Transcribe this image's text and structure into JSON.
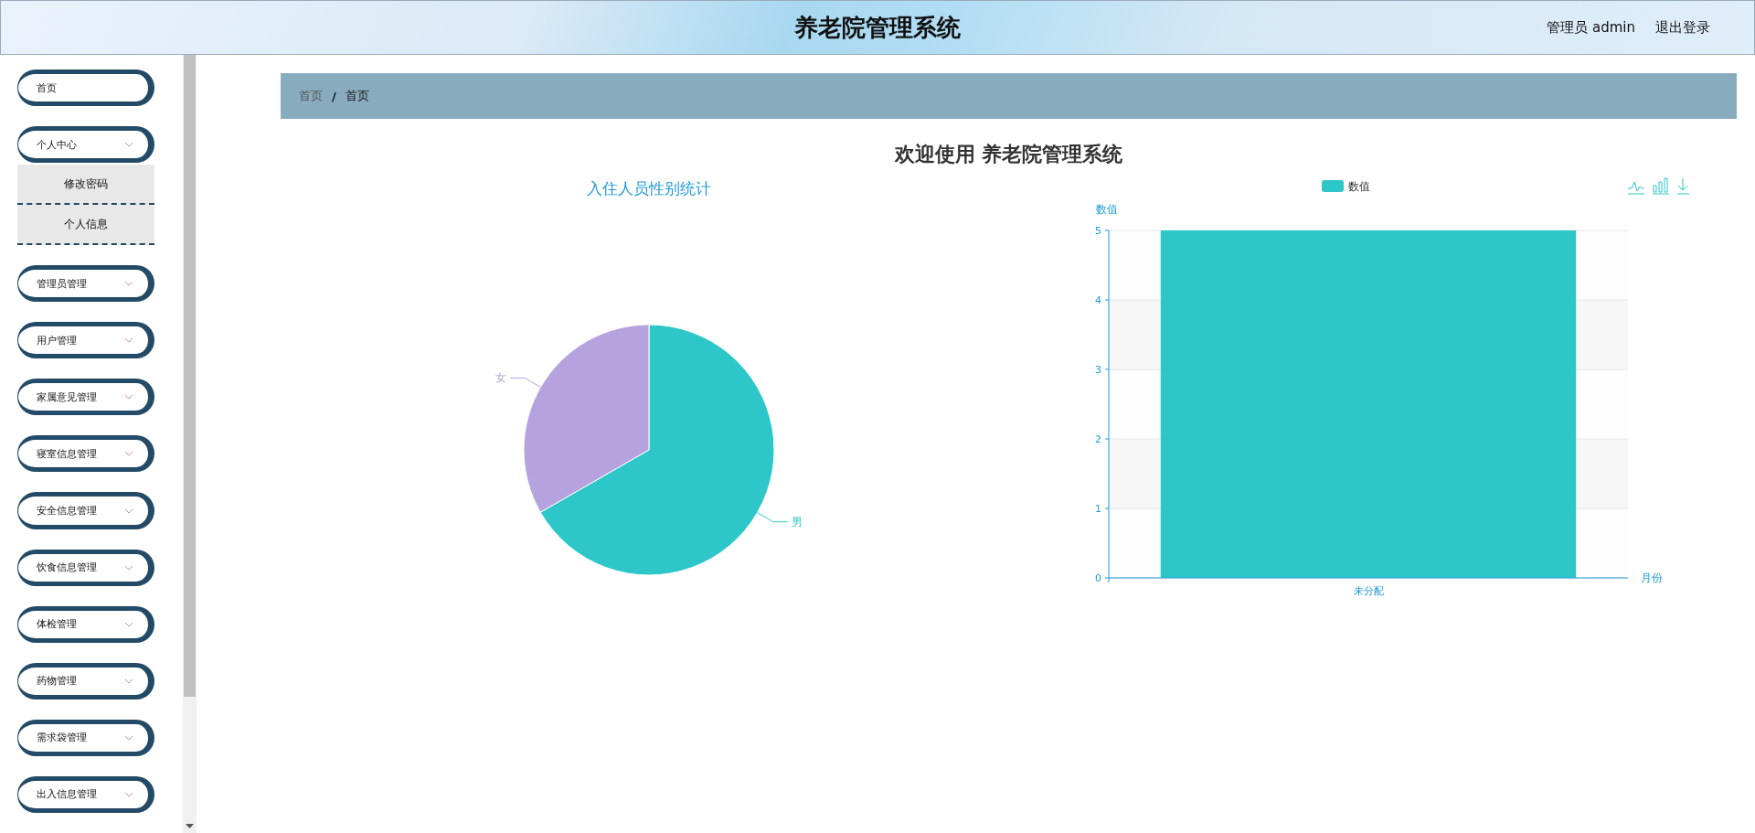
{
  "header": {
    "title": "养老院管理系统",
    "user": "管理员 admin",
    "logout": "退出登录"
  },
  "sidebar": {
    "items": [
      {
        "label": "首页",
        "kind": "link"
      },
      {
        "label": "个人中心",
        "kind": "menu",
        "expanded": true,
        "children": [
          {
            "label": "修改密码"
          },
          {
            "label": "个人信息"
          }
        ]
      },
      {
        "label": "管理员管理",
        "kind": "menu",
        "expanded": false
      },
      {
        "label": "用户管理",
        "kind": "menu",
        "expanded": false
      },
      {
        "label": "家属意见管理",
        "kind": "menu",
        "expanded": false
      },
      {
        "label": "寝室信息管理",
        "kind": "menu",
        "expanded": false
      },
      {
        "label": "安全信息管理",
        "kind": "menu",
        "expanded": false
      },
      {
        "label": "饮食信息管理",
        "kind": "menu",
        "expanded": false
      },
      {
        "label": "体检管理",
        "kind": "menu",
        "expanded": false
      },
      {
        "label": "药物管理",
        "kind": "menu",
        "expanded": false
      },
      {
        "label": "需求袋管理",
        "kind": "menu",
        "expanded": false
      },
      {
        "label": "出入信息管理",
        "kind": "menu",
        "expanded": false
      }
    ]
  },
  "breadcrumb": {
    "items": [
      "首页",
      "首页"
    ],
    "separator": "/"
  },
  "welcome": "欢迎使用 养老院管理系统",
  "pie": {
    "chart_data": {
      "type": "pie",
      "title": "入住人员性别统计",
      "categories": [
        "男",
        "女"
      ],
      "values": [
        66.7,
        33.3
      ],
      "colors": [
        "#2ec7c9",
        "#b6a2de"
      ]
    }
  },
  "bar": {
    "chart_data": {
      "type": "bar",
      "categories": [
        "未分配"
      ],
      "series": [
        {
          "name": "数值",
          "color": "#2ec7c9",
          "values": [
            5
          ]
        }
      ],
      "xlabel": "月份",
      "ylabel": "数值",
      "ylim": [
        0,
        5
      ],
      "grid": true,
      "yticks": [
        0,
        1,
        2,
        3,
        4,
        5
      ]
    }
  }
}
